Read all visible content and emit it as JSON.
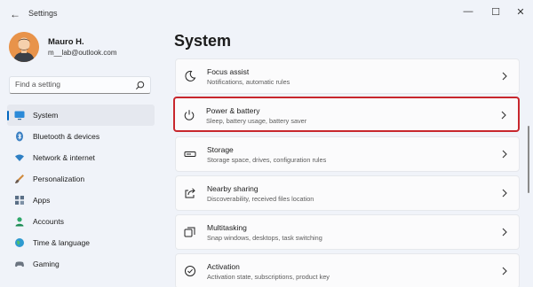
{
  "window": {
    "title": "Settings",
    "back_glyph": "←",
    "min_glyph": "—",
    "max_glyph": "☐",
    "close_glyph": "✕"
  },
  "profile": {
    "name": "Mauro H.",
    "email": "m__lab@outlook.com"
  },
  "search": {
    "placeholder": "Find a setting"
  },
  "sidebar": {
    "items": [
      {
        "label": "System",
        "icon": "monitor-icon",
        "active": true
      },
      {
        "label": "Bluetooth & devices",
        "icon": "bluetooth-icon"
      },
      {
        "label": "Network & internet",
        "icon": "wifi-icon"
      },
      {
        "label": "Personalization",
        "icon": "brush-icon"
      },
      {
        "label": "Apps",
        "icon": "apps-icon"
      },
      {
        "label": "Accounts",
        "icon": "person-icon"
      },
      {
        "label": "Time & language",
        "icon": "globe-icon"
      },
      {
        "label": "Gaming",
        "icon": "gamepad-icon"
      }
    ]
  },
  "main": {
    "title": "System",
    "cards": [
      {
        "title": "Focus assist",
        "subtitle": "Notifications, automatic rules",
        "icon": "moon-icon"
      },
      {
        "title": "Power & battery",
        "subtitle": "Sleep, battery usage, battery saver",
        "icon": "power-icon",
        "highlighted": true
      },
      {
        "title": "Storage",
        "subtitle": "Storage space, drives, configuration rules",
        "icon": "storage-icon"
      },
      {
        "title": "Nearby sharing",
        "subtitle": "Discoverability, received files location",
        "icon": "share-icon"
      },
      {
        "title": "Multitasking",
        "subtitle": "Snap windows, desktops, task switching",
        "icon": "multitask-icon"
      },
      {
        "title": "Activation",
        "subtitle": "Activation state, subscriptions, product key",
        "icon": "activation-icon"
      }
    ]
  },
  "colors": {
    "accent": "#0067c0",
    "highlight_border": "#c8272d",
    "background": "#f0f3f9"
  }
}
